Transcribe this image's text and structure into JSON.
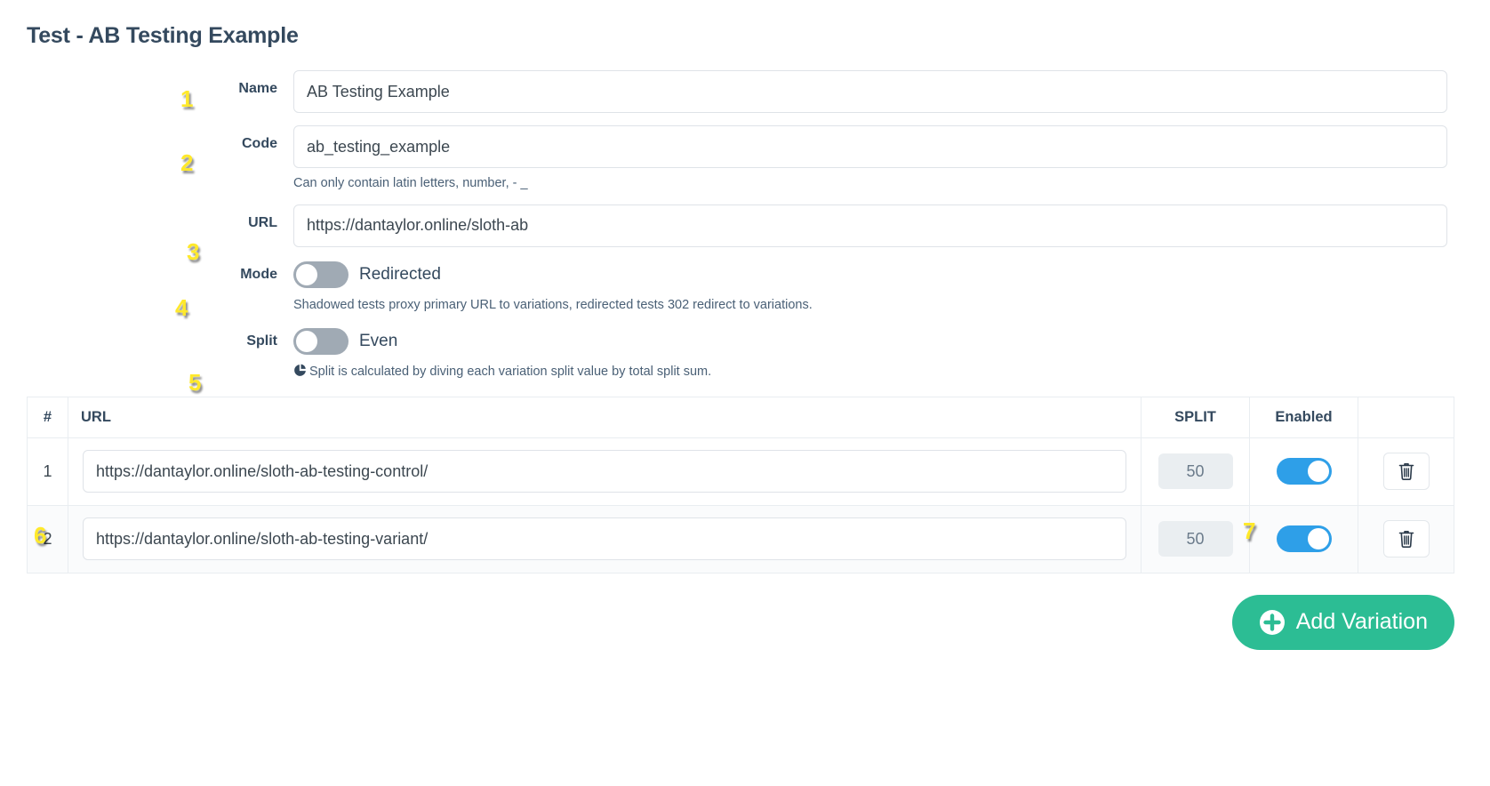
{
  "page": {
    "title": "Test - AB Testing Example"
  },
  "form": {
    "name": {
      "label": "Name",
      "value": "AB Testing Example",
      "marker": "1"
    },
    "code": {
      "label": "Code",
      "value": "ab_testing_example",
      "help": "Can only contain latin letters, number, - _",
      "marker": "2"
    },
    "url": {
      "label": "URL",
      "value": "https://dantaylor.online/sloth-ab",
      "marker": "3"
    },
    "mode": {
      "label": "Mode",
      "toggle_state": "off",
      "toggle_text": "Redirected",
      "help": "Shadowed tests proxy primary URL to variations, redirected tests 302 redirect to variations.",
      "marker": "4"
    },
    "split": {
      "label": "Split",
      "toggle_state": "off",
      "toggle_text": "Even",
      "help": "Split is calculated by diving each variation split value by total split sum.",
      "help_icon": "pie-chart-icon",
      "marker": "5"
    }
  },
  "table": {
    "marker": "6",
    "columns": {
      "num": "#",
      "url": "URL",
      "split": "SPLIT",
      "enabled": "Enabled",
      "actions": ""
    },
    "rows": [
      {
        "num": "1",
        "url": "https://dantaylor.online/sloth-ab-testing-control/",
        "split": "50",
        "enabled": "on",
        "delete_icon": "trash-icon"
      },
      {
        "num": "2",
        "url": "https://dantaylor.online/sloth-ab-testing-variant/",
        "split": "50",
        "enabled": "on",
        "delete_icon": "trash-icon"
      }
    ],
    "enabled_marker": "7"
  },
  "footer": {
    "add_variation_label": "Add Variation",
    "add_variation_icon": "plus-circle-icon"
  },
  "colors": {
    "accent_green": "#2cbd94",
    "toggle_on_blue": "#2e9fe8",
    "toggle_off_gray": "#a0aab4",
    "text_dark": "#34495e",
    "marker_yellow": "#ffe92b"
  }
}
